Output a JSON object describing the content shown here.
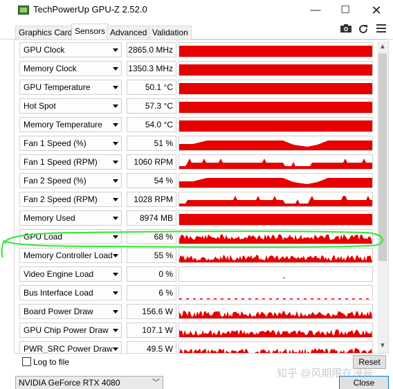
{
  "window": {
    "title": "TechPowerUp GPU-Z 2.52.0",
    "minimize_glyph": "—",
    "maximize_glyph": "☐",
    "close_glyph": "✕"
  },
  "tabs": [
    {
      "label": "Graphics Card",
      "active": false
    },
    {
      "label": "Sensors",
      "active": true
    },
    {
      "label": "Advanced",
      "active": false
    },
    {
      "label": "Validation",
      "active": false
    }
  ],
  "toolbar": {
    "camera_icon": "camera-icon",
    "refresh_icon": "refresh-icon",
    "menu_icon": "menu-icon"
  },
  "colors": {
    "graph_fill": "#e60000",
    "highlight_loop": "#2ee82e"
  },
  "sensors": [
    {
      "name": "GPU Clock",
      "value": "2865.0 MHz",
      "graph": "full"
    },
    {
      "name": "Memory Clock",
      "value": "1350.3 MHz",
      "graph": "full"
    },
    {
      "name": "GPU Temperature",
      "value": "50.1 °C",
      "graph": "full"
    },
    {
      "name": "Hot Spot",
      "value": "57.3 °C",
      "graph": "full"
    },
    {
      "name": "Memory Temperature",
      "value": "54.0 °C",
      "graph": "full"
    },
    {
      "name": "Fan 1 Speed (%)",
      "value": "51 %",
      "graph": "dip"
    },
    {
      "name": "Fan 1 Speed (RPM)",
      "value": "1060 RPM",
      "graph": "dip-spiky"
    },
    {
      "name": "Fan 2 Speed (%)",
      "value": "54 %",
      "graph": "dip"
    },
    {
      "name": "Fan 2 Speed (RPM)",
      "value": "1028 RPM",
      "graph": "dip-spiky"
    },
    {
      "name": "Memory Used",
      "value": "8974 MB",
      "graph": "full"
    },
    {
      "name": "GPU Load",
      "value": "68 %",
      "graph": "spiky-high"
    },
    {
      "name": "Memory Controller Load",
      "value": "55 %",
      "graph": "spiky-mid"
    },
    {
      "name": "Video Engine Load",
      "value": "0 %",
      "graph": "empty"
    },
    {
      "name": "Bus Interface Load",
      "value": "6 %",
      "graph": "dashed"
    },
    {
      "name": "Board Power Draw",
      "value": "156.6 W",
      "graph": "spiky-mid"
    },
    {
      "name": "GPU Chip Power Draw",
      "value": "107.1 W",
      "graph": "spiky-mid"
    },
    {
      "name": "PWR_SRC Power Draw",
      "value": "49.5 W",
      "graph": "spiky-mid"
    }
  ],
  "bottom": {
    "log_label": "Log to file",
    "reset_label": "Reset",
    "close_label": "Close",
    "device": "NVIDIA GeForce RTX 4080",
    "watermark": "知乎 @风期限在浸辰"
  }
}
